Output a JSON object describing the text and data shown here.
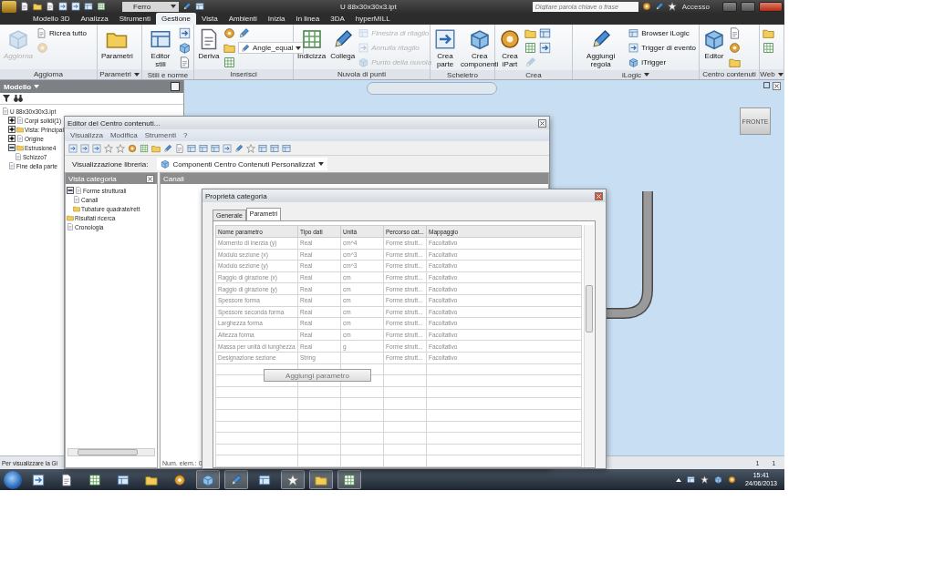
{
  "title_bar": {
    "style_field": "Ferro",
    "file_title": "U 88x30x30x3.ipt",
    "search": {
      "placeholder": "Digitare parola chiave o frase"
    },
    "sign_in": "Accesso"
  },
  "ribbon_tabs": [
    {
      "label": "Modello 3D",
      "selected": false
    },
    {
      "label": "Analizza",
      "selected": false
    },
    {
      "label": "Strumenti",
      "selected": false
    },
    {
      "label": "Gestione",
      "selected": true
    },
    {
      "label": "Vista",
      "selected": false
    },
    {
      "label": "Ambienti",
      "selected": false
    },
    {
      "label": "Inizia",
      "selected": false
    },
    {
      "label": "In linea",
      "selected": false
    },
    {
      "label": "3DA",
      "selected": false
    },
    {
      "label": "hyperMILL",
      "selected": false
    }
  ],
  "ribbon_groups": [
    {
      "label": "Aggiorna",
      "menu": false,
      "items": [
        {
          "kind": "large",
          "label": "Aggiorna",
          "disabled": true
        },
        {
          "kind": "small",
          "label": "Ricrea tutto",
          "disabled": false
        },
        {
          "kind": "icon",
          "disabled": true
        }
      ]
    },
    {
      "label": "Parametri",
      "menu": true,
      "items": [
        {
          "kind": "large",
          "label": "Parametri",
          "disabled": false
        }
      ]
    },
    {
      "label": "Stili e norme",
      "menu": false,
      "items": [
        {
          "kind": "large",
          "label": "Editor stili",
          "disabled": false
        },
        {
          "kind": "icon",
          "disabled": false
        },
        {
          "kind": "icon",
          "disabled": false
        },
        {
          "kind": "icon",
          "disabled": false
        }
      ]
    },
    {
      "label": "Inserisci",
      "menu": false,
      "items": [
        {
          "kind": "large",
          "label": "Deriva",
          "disabled": false
        },
        {
          "kind": "icon",
          "disabled": false
        },
        {
          "kind": "icon",
          "disabled": false
        },
        {
          "kind": "icon",
          "disabled": false
        },
        {
          "kind": "icon",
          "disabled": false
        },
        {
          "kind": "combo",
          "label": "Angle_equal",
          "disabled": false
        }
      ]
    },
    {
      "label": "Nuvola di punti",
      "menu": false,
      "items": [
        {
          "kind": "large",
          "label": "Indicizza",
          "disabled": false
        },
        {
          "kind": "large",
          "label": "Collega",
          "disabled": false
        },
        {
          "kind": "small",
          "label": "Finestra di ritaglio",
          "disabled": true
        },
        {
          "kind": "small",
          "label": "Annulla ritaglio",
          "disabled": true
        },
        {
          "kind": "small",
          "label": "Punto della nuvola",
          "disabled": true
        }
      ]
    },
    {
      "label": "Scheletro",
      "menu": false,
      "items": [
        {
          "kind": "large",
          "label": "Crea\nparte",
          "disabled": false
        },
        {
          "kind": "large",
          "label": "Crea\ncomponenti",
          "disabled": false
        }
      ]
    },
    {
      "label": "Crea",
      "menu": false,
      "items": [
        {
          "kind": "large",
          "label": "Crea\niPart",
          "disabled": false
        },
        {
          "kind": "icon",
          "disabled": false
        },
        {
          "kind": "icon",
          "disabled": false
        },
        {
          "kind": "icon",
          "disabled": true
        },
        {
          "kind": "icon",
          "disabled": false
        },
        {
          "kind": "icon",
          "disabled": false
        }
      ]
    },
    {
      "label": "iLogic",
      "menu": true,
      "items": [
        {
          "kind": "large",
          "label": "Aggiungi regola",
          "disabled": false
        },
        {
          "kind": "small",
          "label": "Browser iLogic",
          "disabled": false
        },
        {
          "kind": "small",
          "label": "Trigger di evento",
          "disabled": false
        },
        {
          "kind": "small",
          "label": "iTrigger",
          "disabled": false
        }
      ]
    },
    {
      "label": "Centro contenuti",
      "menu": false,
      "items": [
        {
          "kind": "large",
          "label": "Editor",
          "disabled": false
        },
        {
          "kind": "icon",
          "disabled": false
        },
        {
          "kind": "icon",
          "disabled": false
        },
        {
          "kind": "icon",
          "disabled": false
        }
      ]
    },
    {
      "label": "Web",
      "menu": true,
      "items": [
        {
          "kind": "icon",
          "disabled": false
        },
        {
          "kind": "icon",
          "disabled": false
        }
      ]
    }
  ],
  "browser": {
    "title": "Modello",
    "tree": [
      {
        "label": "U 88x30x30x3.ipt",
        "children": [
          {
            "label": "Corpi solidi(1)",
            "expanded": false
          },
          {
            "label": "Vista: Principal",
            "expanded": false
          },
          {
            "label": "Origine",
            "expanded": false
          },
          {
            "label": "Estrusione4",
            "expanded": true,
            "children": [
              {
                "label": "Schizzo7"
              }
            ]
          },
          {
            "label": "Fine della parte"
          }
        ]
      }
    ]
  },
  "view_cube": "FRONTE",
  "content_editor": {
    "title": "Editor del Centro contenuti...",
    "menu": [
      "Visualizza",
      "Modifica",
      "Strumenti",
      "?"
    ],
    "library_label": "Visualizzazione libreria:",
    "library_value": "Componenti Centro Contenuti Personalizzat",
    "category_pane": {
      "title": "Vista categoria",
      "tree": [
        {
          "label": "Forme strutturali",
          "expanded": true,
          "children": [
            {
              "label": "Canali"
            },
            {
              "label": "Tubature quadrate/rett"
            }
          ]
        },
        {
          "label": "Risultati ricerca"
        },
        {
          "label": "Cronologia"
        }
      ]
    },
    "content_title": "Canali",
    "status": "Num. elem.: 0"
  },
  "category_properties": {
    "title": "Proprietà categoria",
    "tabs": [
      {
        "label": "Generale",
        "selected": false
      },
      {
        "label": "Parametri",
        "selected": true
      }
    ],
    "columns": [
      "Nome parametro",
      "Tipo dati",
      "Unità",
      "Percorso cat...",
      "Mappaggio"
    ],
    "rows": [
      [
        "Momento di inerzia (y)",
        "Real",
        "cm^4",
        "Forme strutt...",
        "Facoltativo"
      ],
      [
        "Modulo sezione (x)",
        "Real",
        "cm^3",
        "Forme strutt...",
        "Facoltativo"
      ],
      [
        "Modulo sezione (y)",
        "Real",
        "cm^3",
        "Forme strutt...",
        "Facoltativo"
      ],
      [
        "Raggio di girazione (x)",
        "Real",
        "cm",
        "Forme strutt...",
        "Facoltativo"
      ],
      [
        "Raggio di girazione (y)",
        "Real",
        "cm",
        "Forme strutt...",
        "Facoltativo"
      ],
      [
        "Spessore forma",
        "Real",
        "cm",
        "Forme strutt...",
        "Facoltativo"
      ],
      [
        "Spessore seconda forma",
        "Real",
        "cm",
        "Forme strutt...",
        "Facoltativo"
      ],
      [
        "Larghezza forma",
        "Real",
        "cm",
        "Forme strutt...",
        "Facoltativo"
      ],
      [
        "Altezza forma",
        "Real",
        "cm",
        "Forme strutt...",
        "Facoltativo"
      ],
      [
        "Massa per unità di lunghezza",
        "Real",
        "g",
        "Forme strutt...",
        "Facoltativo"
      ],
      [
        "Designazione sezione",
        "String",
        "",
        "Forme strutt...",
        "Facoltativo"
      ]
    ],
    "add_button": "Aggiungi parametro"
  },
  "status_bar": {
    "message": "Per visualizzare la Gi",
    "counters": [
      "1",
      "1"
    ]
  },
  "taskbar": {
    "time": "15:41",
    "date": "24/06/2013"
  }
}
